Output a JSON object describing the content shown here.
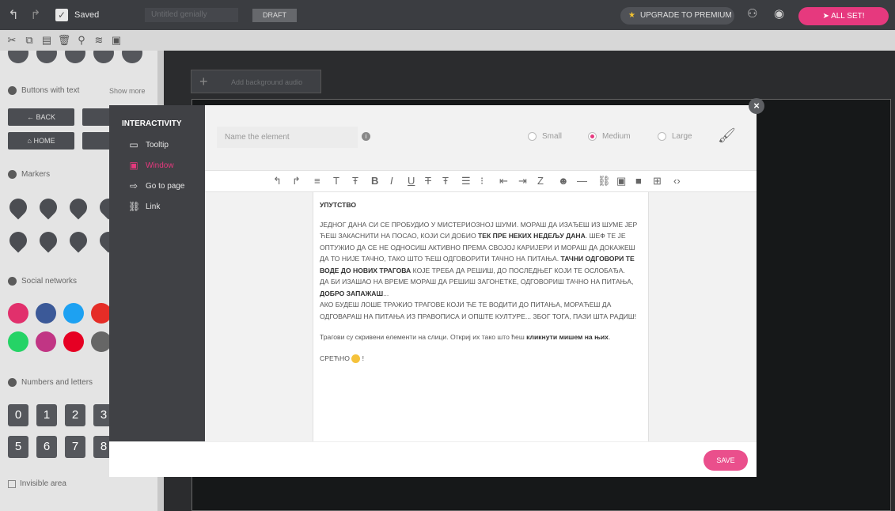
{
  "topbar": {
    "saved": "Saved",
    "title_placeholder": "Untitled genially",
    "draft": "DRAFT",
    "upgrade": "UPGRADE TO PREMIUM",
    "allset": "ALL SET!"
  },
  "left": {
    "buttons_with_text": "Buttons with text",
    "show_more": "Show more",
    "back": "← BACK",
    "close_trunc": "X CL",
    "home": "⌂ HOME",
    "search_trunc": "Q SE",
    "markers": "Markers",
    "social": "Social networks",
    "numbers": "Numbers and letters",
    "digits": [
      "0",
      "1",
      "2",
      "3",
      "5",
      "6",
      "7",
      "8"
    ],
    "invisible": "Invisible area"
  },
  "canvas": {
    "background_auto": "Add background audio"
  },
  "modal": {
    "interactivity": "INTERACTIVITY",
    "menu": [
      "Tooltip",
      "Window",
      "Go to page",
      "Link"
    ],
    "name_placeholder": "Name the element",
    "sizes": [
      "Small",
      "Medium",
      "Large"
    ],
    "save": "SAVE",
    "doc": {
      "title": "УПУТСТВО",
      "p1a": "ЈЕДНОГ ДАНА СИ СЕ ПРОБУДИО У МИСТЕРИОЗНОЈ ШУМИ. МОРАШ ДА ИЗАЂЕШ ИЗ ШУМЕ ЈЕР ЋЕШ ЗАКАСНИТИ НА ПОСАО, КОЈИ СИ ДОБИО ",
      "p1b": "ТЕК ПРЕ НЕКИХ НЕДЕЉУ ДАНА",
      "p1c": ". ШЕФ ТЕ ЈЕ ОПТУЖИО ДА СЕ НЕ ОДНОСИШ АКТИВНО ПРЕМА СВОЈОЈ КАРИЈЕРИ И МОРАШ ДА ДОКАЖЕШ ДА ТО НИЈЕ ТАЧНО, ТАКО ШТО ЋЕШ ОДГОВОРИТИ ТАЧНО НА ПИТАЊА. ",
      "p1d": "ТАЧНИ ОДГОВОРИ ТЕ ВОДЕ ДО НОВИХ ТРАГОВА",
      "p1e": " КОЈЕ ТРЕБА ДА РЕШИШ, ДО ПОСЛЕДЊЕГ КОЈИ ТЕ ОСЛОБАЂА.",
      "p2a": "ДА БИ ИЗАШАО НА ВРЕМЕ МОРАШ ДА РЕШИШ ЗАГОНЕТКЕ, ОДГОВОРИШ ТАЧНО НА ПИТАЊА, ",
      "p2b": "ДОБРО ЗАПАЖАШ",
      "p2c": "...",
      "p3": "АКО БУДЕШ ЛОШЕ ТРАЖИО ТРАГОВЕ КОЈИ ЋЕ ТЕ ВОДИТИ ДО ПИТАЊА, МОРАЋЕШ ДА ОДГОВАРАШ НА ПИТАЊА ИЗ ПРАВОПИСА И ОПШТЕ КУЛТУРЕ... ЗБОГ ТОГА, ПАЗИ ШТА РАДИШ!",
      "p4a": "Трагови су скривени елементи на слици. Откриј их тако што ћеш ",
      "p4b": "кликнути мишем на њих",
      "p4c": ".",
      "p5": "СРЕЋНО",
      "p5b": " !"
    }
  }
}
